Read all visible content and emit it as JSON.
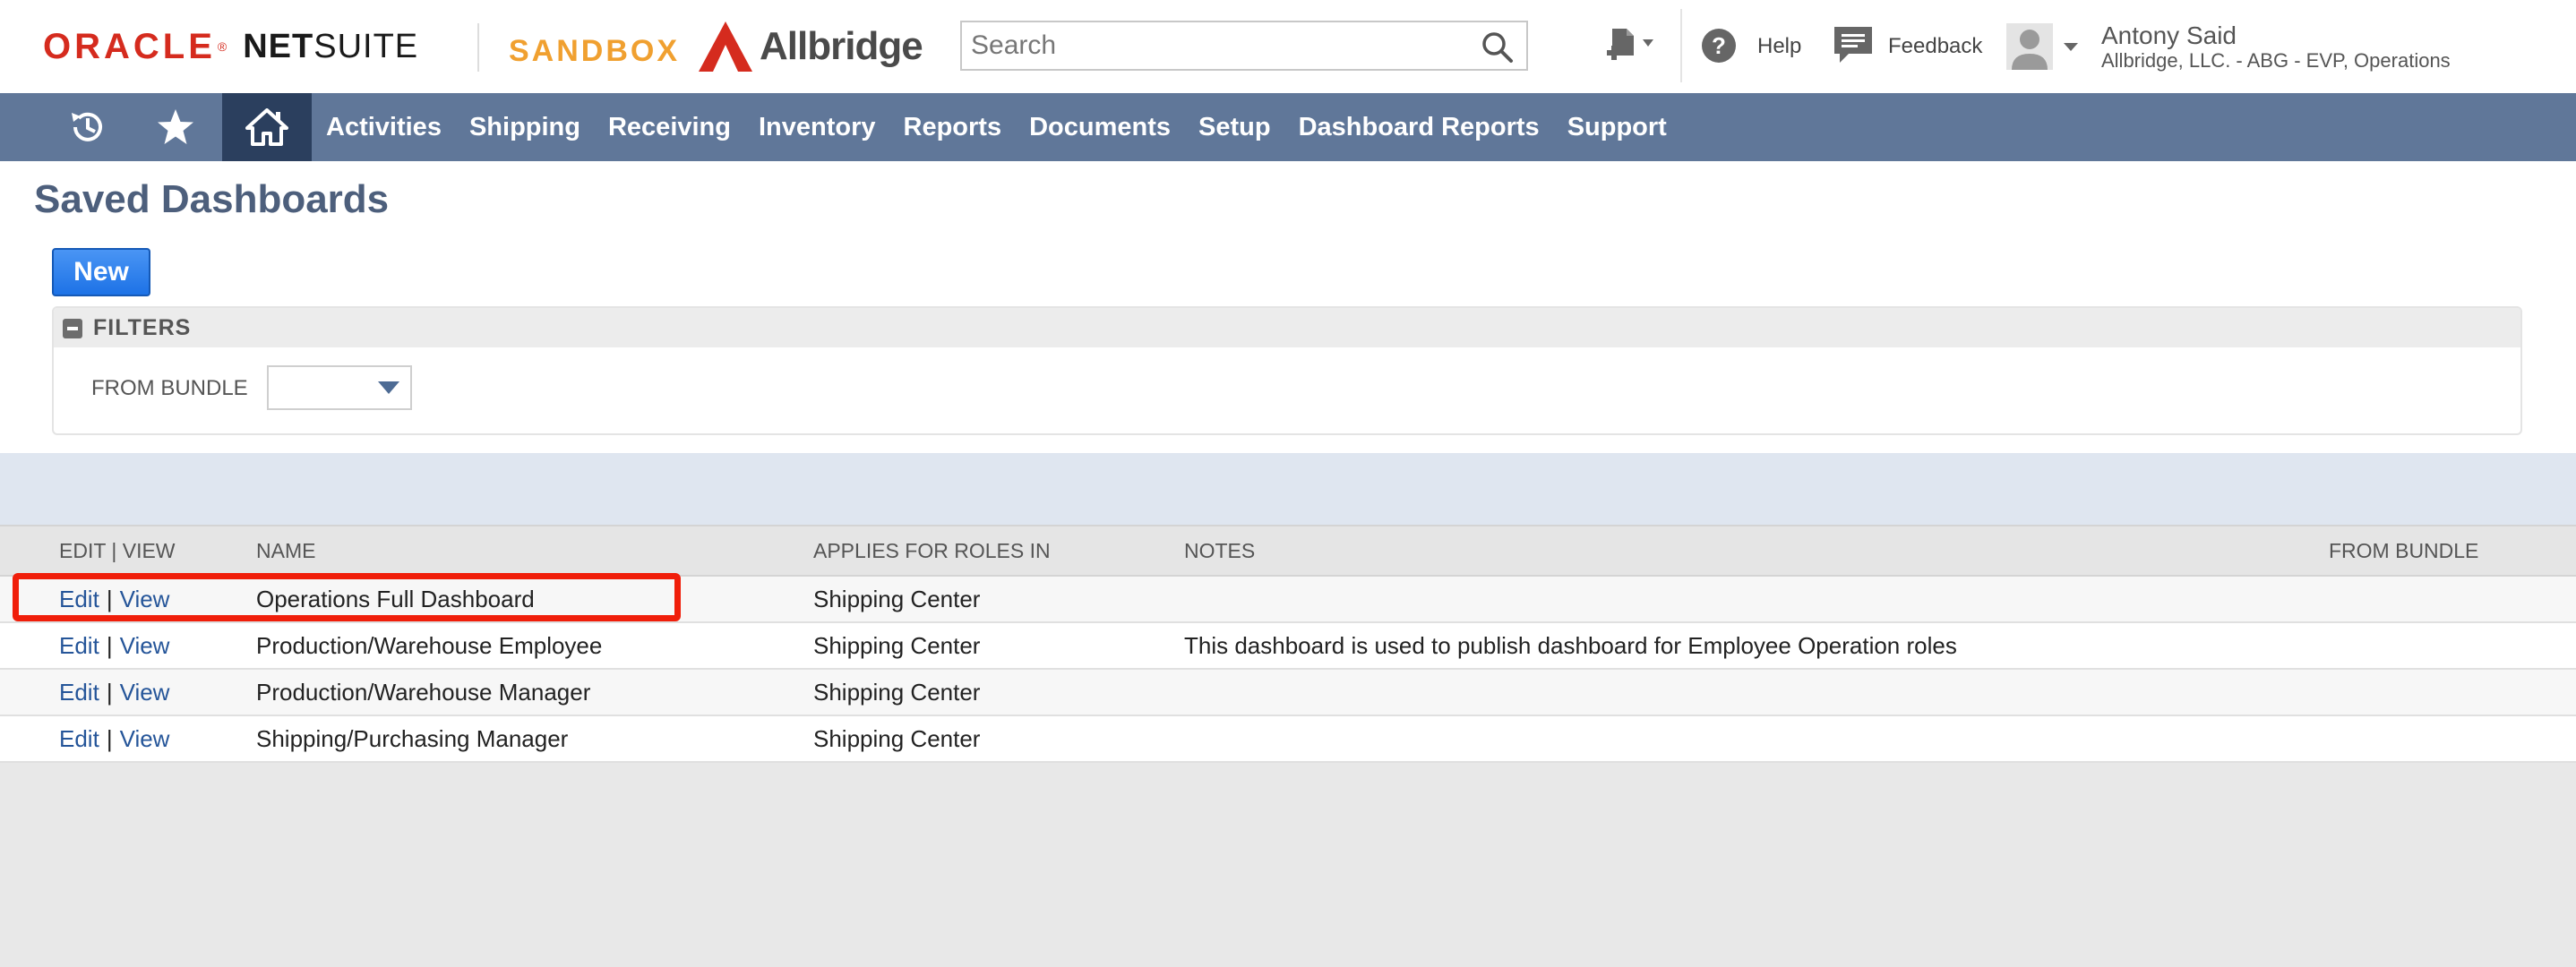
{
  "header": {
    "oracle": "ORACLE",
    "netsuite_bold": "NET",
    "netsuite_rest": "SUITE",
    "environment": "SANDBOX",
    "company_logo_text": "Allbridge",
    "search_placeholder": "Search",
    "help_label": "Help",
    "feedback_label": "Feedback",
    "user_name": "Antony Said",
    "user_role": "Allbridge, LLC. - ABG - EVP, Operations",
    "icons": [
      "create-new-icon",
      "help-icon",
      "feedback-icon",
      "avatar-icon",
      "search-icon"
    ],
    "colors": {
      "oracle_red": "#d52b1e",
      "sandbox_orange": "#f0a030"
    }
  },
  "nav": {
    "icons": [
      "recent-records-icon",
      "favorites-star-icon",
      "home-icon"
    ],
    "items": [
      "Activities",
      "Shipping",
      "Receiving",
      "Inventory",
      "Reports",
      "Documents",
      "Setup",
      "Dashboard Reports",
      "Support"
    ],
    "colors": {
      "bar": "#607799",
      "home_active": "#2b3f5e"
    }
  },
  "page": {
    "title": "Saved Dashboards",
    "new_button": "New"
  },
  "filters": {
    "title": "FILTERS",
    "from_bundle_label": "FROM BUNDLE",
    "from_bundle_value": ""
  },
  "table": {
    "headers": [
      "EDIT | VIEW",
      "NAME",
      "APPLIES FOR ROLES IN",
      "NOTES",
      "FROM BUNDLE"
    ],
    "edit_label": "Edit",
    "separator": "|",
    "view_label": "View",
    "rows": [
      {
        "name": "Operations Full Dashboard",
        "roles": "Shipping Center",
        "notes": "",
        "bundle": ""
      },
      {
        "name": "Production/Warehouse Employee",
        "roles": "Shipping Center",
        "notes": "This dashboard is used to publish dashboard for Employee Operation roles",
        "bundle": ""
      },
      {
        "name": "Production/Warehouse Manager",
        "roles": "Shipping Center",
        "notes": "",
        "bundle": ""
      },
      {
        "name": "Shipping/Purchasing Manager",
        "roles": "Shipping Center",
        "notes": "",
        "bundle": ""
      }
    ],
    "highlight_color": "#f01e0a"
  }
}
